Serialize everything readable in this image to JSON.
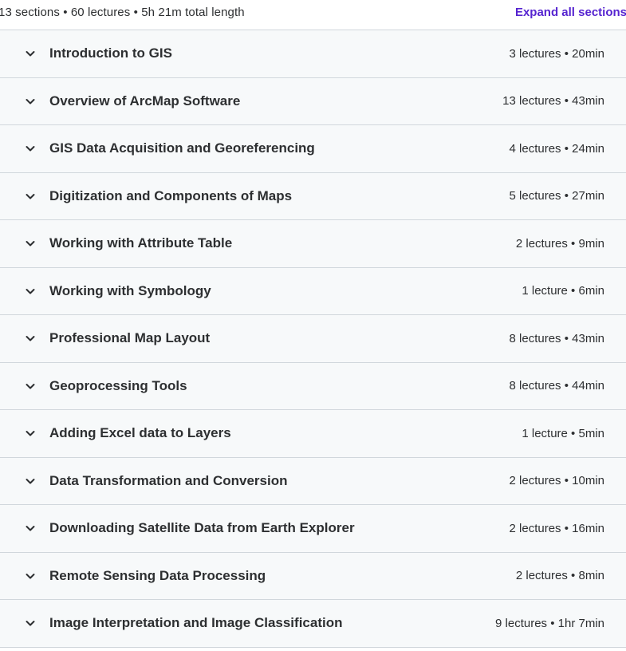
{
  "summary": {
    "text": "13 sections • 60 lectures • 5h 21m total length",
    "expand_label": "Expand all sections"
  },
  "sections": [
    {
      "title": "Introduction to GIS",
      "meta": "3 lectures • 20min"
    },
    {
      "title": "Overview of ArcMap Software",
      "meta": "13 lectures • 43min"
    },
    {
      "title": "GIS Data Acquisition and Georeferencing",
      "meta": "4 lectures • 24min"
    },
    {
      "title": "Digitization and Components of Maps",
      "meta": "5 lectures • 27min"
    },
    {
      "title": "Working with Attribute Table",
      "meta": "2 lectures • 9min"
    },
    {
      "title": "Working with Symbology",
      "meta": "1 lecture • 6min"
    },
    {
      "title": "Professional Map Layout",
      "meta": "8 lectures • 43min"
    },
    {
      "title": "Geoprocessing Tools",
      "meta": "8 lectures • 44min"
    },
    {
      "title": "Adding Excel data to Layers",
      "meta": "1 lecture • 5min"
    },
    {
      "title": "Data Transformation and Conversion",
      "meta": "2 lectures • 10min"
    },
    {
      "title": "Downloading Satellite Data from Earth Explorer",
      "meta": "2 lectures • 16min"
    },
    {
      "title": "Remote Sensing Data Processing",
      "meta": "2 lectures • 8min"
    },
    {
      "title": "Image Interpretation and Image Classification",
      "meta": "9 lectures • 1hr 7min"
    }
  ],
  "icons": {
    "section_toggle": "chevron-down-icon"
  },
  "colors": {
    "accent": "#5624d0",
    "row_background": "#f7f9fa",
    "border": "#d1d7dc",
    "text": "#2d2f31"
  }
}
